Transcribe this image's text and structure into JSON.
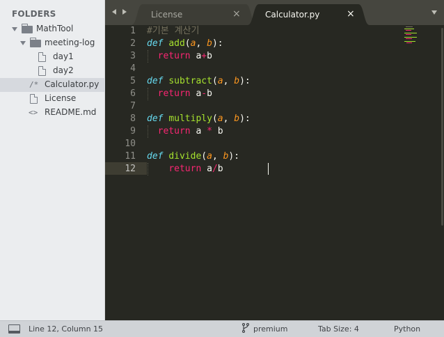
{
  "sidebar": {
    "header": "FOLDERS",
    "items": [
      {
        "label": "MathTool",
        "icon": "folder-open-icon"
      },
      {
        "label": "meeting-log",
        "icon": "folder-open-icon"
      },
      {
        "label": "day1",
        "icon": "file-icon"
      },
      {
        "label": "day2",
        "icon": "file-icon"
      },
      {
        "label": "Calculator.py",
        "icon": "python-file-icon",
        "glyph": "/*"
      },
      {
        "label": "License",
        "icon": "file-icon"
      },
      {
        "label": "README.md",
        "icon": "markdown-file-icon",
        "glyph": "<>"
      }
    ]
  },
  "tabs": [
    {
      "label": "License",
      "close": "×",
      "active": false
    },
    {
      "label": "Calculator.py",
      "close": "×",
      "active": true
    }
  ],
  "editor": {
    "line_numbers": [
      "1",
      "2",
      "3",
      "4",
      "5",
      "6",
      "7",
      "8",
      "9",
      "10",
      "11",
      "12"
    ],
    "current_line": 12,
    "code": {
      "l1": "#기본 계산기",
      "def": "def",
      "return": "return",
      "add": "add",
      "subtract": "subtract",
      "multiply": "multiply",
      "divide": "divide",
      "a": "a",
      "b": "b"
    }
  },
  "colors": {
    "background": "#272822",
    "keyword": "#66d9ef",
    "function": "#a6e22e",
    "parameter": "#fd971f",
    "return": "#f92672",
    "comment": "#75715e"
  },
  "statusbar": {
    "position": "Line 12, Column 15",
    "branch": "premium",
    "tab_size": "Tab Size: 4",
    "syntax": "Python"
  }
}
